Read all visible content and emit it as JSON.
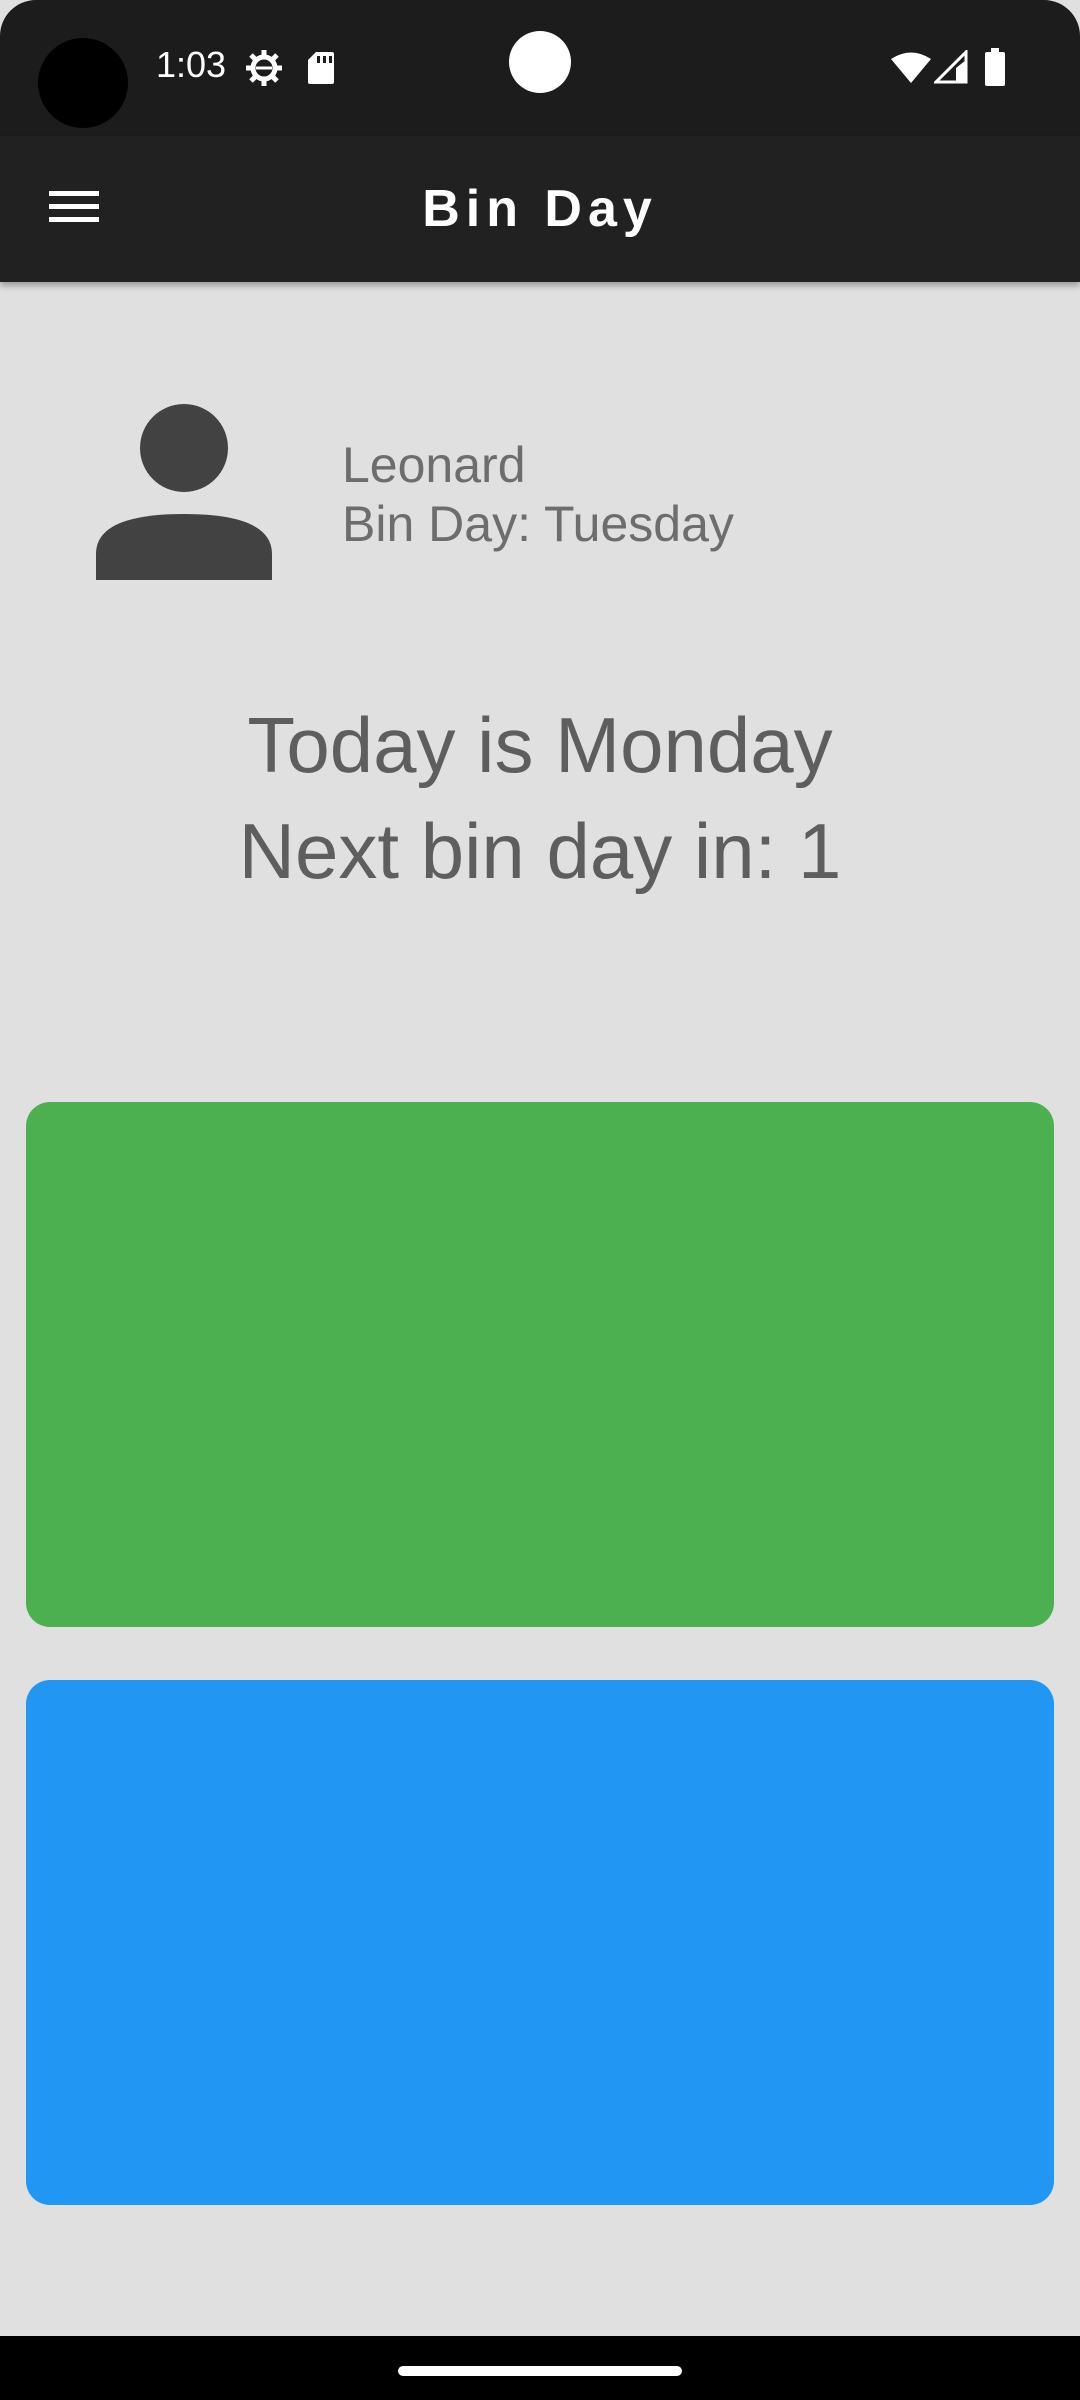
{
  "status_bar": {
    "time": "1:03",
    "icons": [
      "settings-gear-icon",
      "sd-card-icon",
      "wifi-icon",
      "cell-signal-icon",
      "battery-icon"
    ]
  },
  "app_bar": {
    "title": "Bin Day",
    "menu_icon": "hamburger-menu-icon"
  },
  "profile": {
    "avatar_icon": "person-icon",
    "name": "Leonard",
    "bin_day": "Bin Day: Tuesday"
  },
  "main": {
    "today": "Today is Monday",
    "next_bin": "Next bin day in: 1"
  },
  "cards": [
    {
      "color": "#4caf50"
    },
    {
      "color": "#2196f3"
    }
  ],
  "colors": {
    "app_bar": "#212121",
    "background": "#e0e0e0"
  }
}
